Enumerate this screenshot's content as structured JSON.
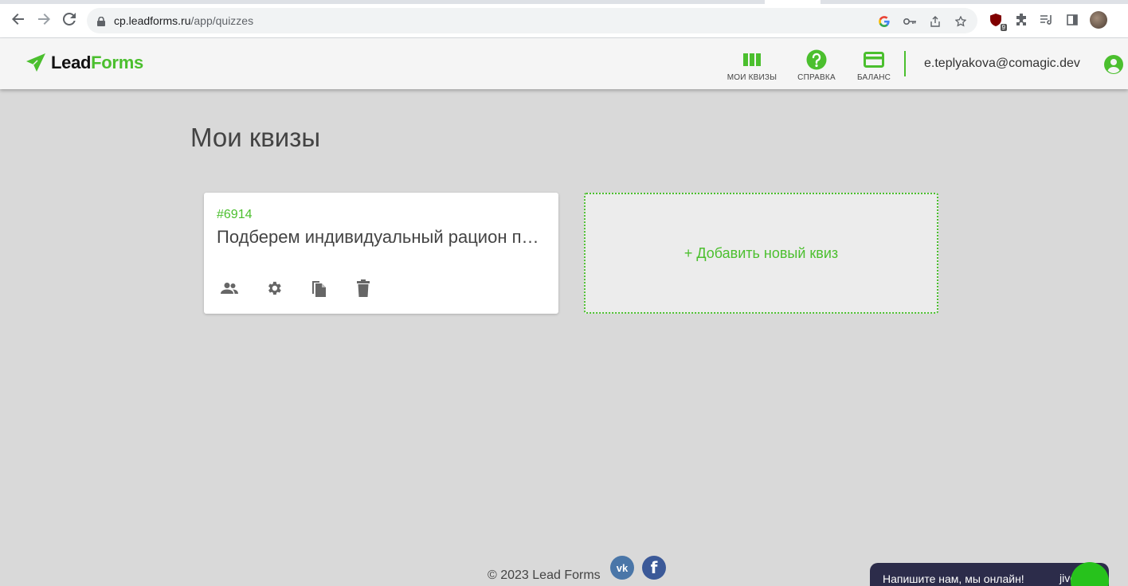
{
  "browser": {
    "url_host": "cp.leadforms.ru",
    "url_path": "/app/quizzes",
    "extension_badge": "9"
  },
  "header": {
    "logo": {
      "lead": "Lead",
      "forms": "Forms"
    },
    "nav": [
      {
        "label": "МОИ КВИЗЫ",
        "icon": "columns-icon"
      },
      {
        "label": "СПРАВКА",
        "icon": "help-icon"
      },
      {
        "label": "БАЛАНС",
        "icon": "credit-card-icon"
      }
    ],
    "user_email": "e.teplyakova@comagic.dev"
  },
  "main": {
    "title": "Мои квизы",
    "quizzes": [
      {
        "id": "#6914",
        "title": "Подберем индивидуальный рацион питания"
      }
    ],
    "add_quiz_label": "+ Добавить новый квиз"
  },
  "footer": {
    "copyright": "© 2023 Lead Forms",
    "vk_label": "vk",
    "fb_label": "f"
  },
  "jivo": {
    "text": "Напишите нам, мы онлайн!",
    "logo": "jivo"
  },
  "colors": {
    "accent": "#4bbf2e",
    "page_bg": "#d9d9d9",
    "jivo_bg": "#2c2c4a"
  }
}
